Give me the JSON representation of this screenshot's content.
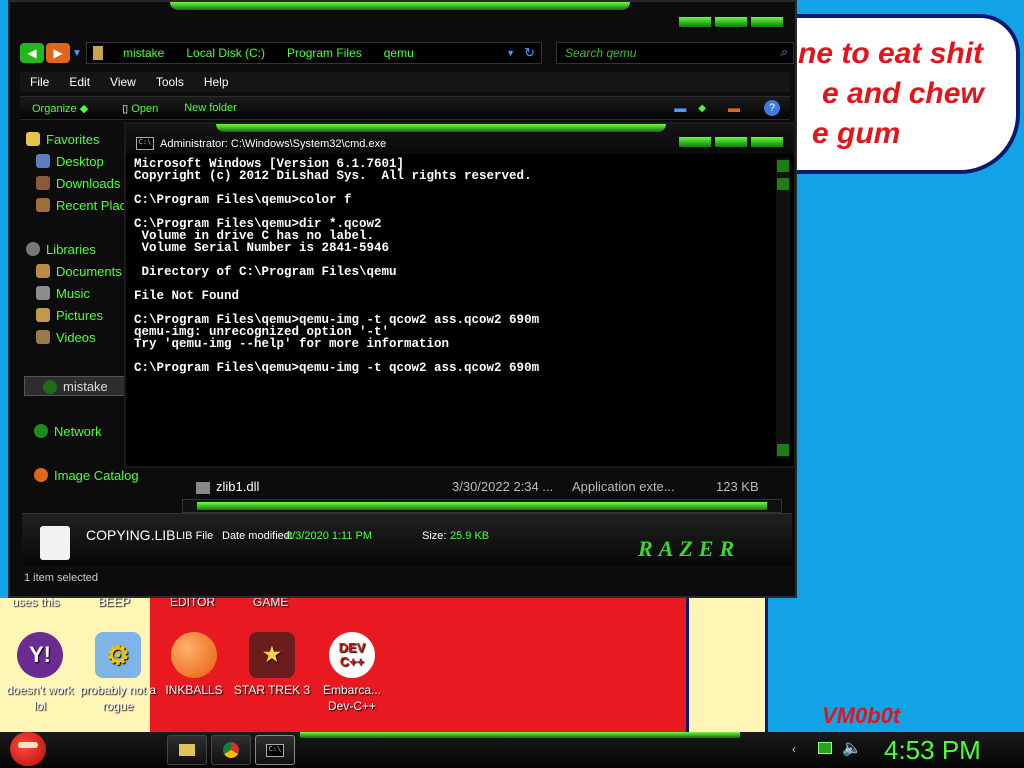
{
  "wallpaper": {
    "speech_lines": [
      "ne to eat shit",
      "e and chew",
      "e gum"
    ],
    "signature": "VM0b0t",
    "accent": "#e3141b"
  },
  "desktop": {
    "top_labels": [
      "uses this",
      "BEEP",
      "EDITOR",
      "GAME"
    ],
    "icons": [
      {
        "icon": "yahoo-messenger-icon",
        "label": "doesn't work lol"
      },
      {
        "icon": "gears-icon",
        "label": "probably not a rogue"
      },
      {
        "icon": "inkball-icon",
        "label": "INKBALLS"
      },
      {
        "icon": "star-trek-icon",
        "label": "STAR TREK 3"
      },
      {
        "icon": "devcpp-icon",
        "label": "Embarca... Dev-C++",
        "glyph": "DEV C++"
      }
    ]
  },
  "explorer": {
    "address_path": [
      "mistake",
      "Local Disk (C:)",
      "Program Files",
      "qemu"
    ],
    "search_placeholder": "Search qemu",
    "menu": [
      "File",
      "Edit",
      "View",
      "Tools",
      "Help"
    ],
    "commands": [
      "Organize",
      "Open",
      "New folder"
    ],
    "sidebar": {
      "favorites": "Favorites",
      "favorites_items": [
        "Desktop",
        "Downloads",
        "Recent Places"
      ],
      "libraries": "Libraries",
      "library_items": [
        "Documents",
        "Music",
        "Pictures",
        "Videos"
      ],
      "homegroup": "mistake",
      "network": "Network",
      "image_catalog": "Image Catalog"
    },
    "file_row": {
      "name": "zlib1.dll",
      "date": "3/30/2022 2:34 ...",
      "type": "Application exte...",
      "size": "123 KB"
    },
    "details": {
      "name": "COPYING.LIB",
      "type": "LIB File",
      "modified_label": "Date modified:",
      "modified_value": "8/3/2020 1:11 PM",
      "size_label": "Size:",
      "size_value": "25.9 KB",
      "brand": "RAZER"
    },
    "status": "1 item selected"
  },
  "cmd": {
    "title": "Administrator: C:\\Windows\\System32\\cmd.exe",
    "icon_text": "C:\\",
    "lines": [
      "Microsoft Windows [Version 6.1.7601]",
      "Copyright (c) 2012 DiLshad Sys.  All rights reserved.",
      "",
      "C:\\Program Files\\qemu>color f",
      "",
      "C:\\Program Files\\qemu>dir *.qcow2",
      " Volume in drive C has no label.",
      " Volume Serial Number is 2841-5946",
      "",
      " Directory of C:\\Program Files\\qemu",
      "",
      "File Not Found",
      "",
      "C:\\Program Files\\qemu>qemu-img -t qcow2 ass.qcow2 690m",
      "qemu-img: unrecognized option '-t'",
      "Try 'qemu-img --help' for more information",
      "",
      "C:\\Program Files\\qemu>qemu-img -t qcow2 ass.qcow2 690m"
    ]
  },
  "taskbar": {
    "clock": "4:53 PM",
    "cmd_button_text": "C:\\",
    "accent": "#4dff3a"
  }
}
